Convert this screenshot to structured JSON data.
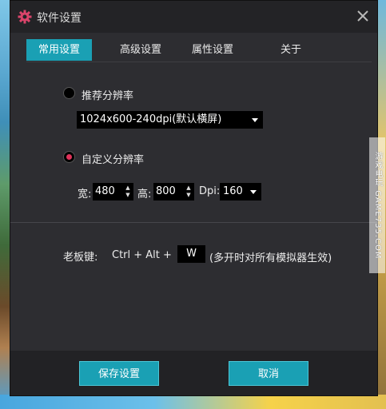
{
  "window": {
    "title": "软件设置"
  },
  "tabs": [
    {
      "label": "常用设置",
      "active": true
    },
    {
      "label": "高级设置",
      "active": false
    },
    {
      "label": "属性设置",
      "active": false
    },
    {
      "label": "关于",
      "active": false
    }
  ],
  "resolution": {
    "recommended_label": "推荐分辨率",
    "recommended_selected": false,
    "recommended_value": "1024x600-240dpi(默认横屏)",
    "custom_label": "自定义分辨率",
    "custom_selected": true,
    "width_label": "宽:",
    "width_value": "480",
    "height_label": "高:",
    "height_value": "800",
    "dpi_label": "Dpi:",
    "dpi_value": "160"
  },
  "boss_key": {
    "label": "老板键:",
    "combo": "Ctrl + Alt +",
    "key": "W",
    "note": "(多开时对所有模拟器生效)"
  },
  "footer": {
    "save_label": "保存设置",
    "cancel_label": "取消"
  },
  "watermark": "游戏电玩 GAME735.COM",
  "colors": {
    "accent": "#1aa0b4",
    "radio_dot": "#e0325a",
    "gear_icon": "#d9446a"
  },
  "icons": [
    "gear-icon",
    "close-icon",
    "chevron-down-icon"
  ]
}
